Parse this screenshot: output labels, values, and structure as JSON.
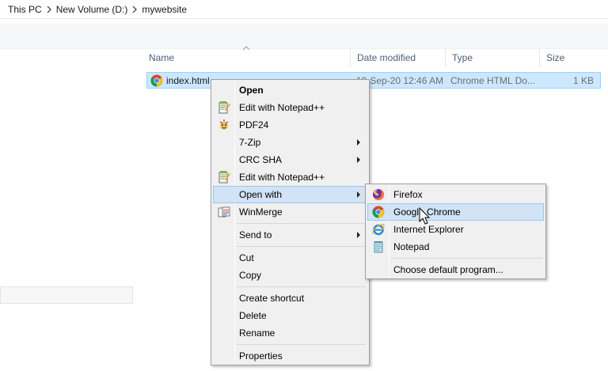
{
  "breadcrumb": [
    "This PC",
    "New Volume (D:)",
    "mywebsite"
  ],
  "columns": {
    "name": "Name",
    "date": "Date modified",
    "type": "Type",
    "size": "Size"
  },
  "file": {
    "name": "index.html",
    "date": "19-Sep-20 12:46 AM",
    "type": "Chrome HTML Do...",
    "size": "1 KB"
  },
  "context_menu": {
    "items": [
      {
        "label": "Open"
      },
      {
        "label": "Edit with Notepad++"
      },
      {
        "label": "PDF24"
      },
      {
        "label": "7-Zip"
      },
      {
        "label": "CRC SHA"
      },
      {
        "label": "Edit with Notepad++"
      },
      {
        "label": "Open with"
      },
      {
        "label": "WinMerge"
      },
      {
        "label": "Send to"
      },
      {
        "label": "Cut"
      },
      {
        "label": "Copy"
      },
      {
        "label": "Create shortcut"
      },
      {
        "label": "Delete"
      },
      {
        "label": "Rename"
      },
      {
        "label": "Properties"
      }
    ]
  },
  "open_with_menu": {
    "items": [
      {
        "label": "Firefox"
      },
      {
        "label": "Google Chrome"
      },
      {
        "label": "Internet Explorer"
      },
      {
        "label": "Notepad"
      },
      {
        "label": "Choose default program..."
      }
    ]
  },
  "colors": {
    "selection_bg": "#cce8ff",
    "selection_border": "#99d1ff",
    "menu_bg": "#f0f0f0",
    "menu_highlight": "#d1e3f5",
    "menu_highlight_border": "#99c9ef",
    "header_text": "#4c607a"
  }
}
